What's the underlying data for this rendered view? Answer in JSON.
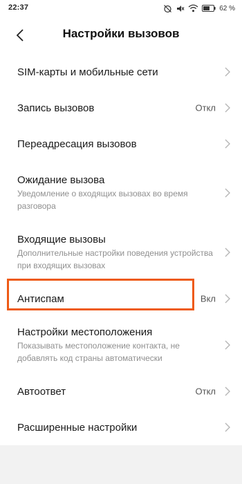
{
  "status_bar": {
    "time": "22:37",
    "battery": "62 %"
  },
  "header": {
    "title": "Настройки вызовов"
  },
  "items": [
    {
      "title": "SIM-карты и мобильные сети"
    },
    {
      "title": "Запись вызовов",
      "value": "Откл"
    },
    {
      "title": "Переадресация вызовов"
    },
    {
      "title": "Ожидание вызова",
      "description": "Уведомление о входящих вызовах во время разговора"
    },
    {
      "title": "Входящие вызовы",
      "description": "Дополнительные настройки поведения устройства при входящих вызовах"
    },
    {
      "title": "Антиспам",
      "value": "Вкл"
    },
    {
      "title": "Настройки местоположения",
      "description": "Показывать местоположение контакта, не добавлять код страны автоматически"
    },
    {
      "title": "Автоответ",
      "value": "Откл"
    },
    {
      "title": "Расширенные настройки"
    }
  ],
  "colors": {
    "highlight": "#ee5a15",
    "background": "#f2f2f2",
    "surface": "#ffffff"
  },
  "icons": [
    "alarm-off-icon",
    "mute-icon",
    "wifi-icon",
    "battery-icon",
    "back-arrow-icon",
    "chevron-right-icon"
  ]
}
